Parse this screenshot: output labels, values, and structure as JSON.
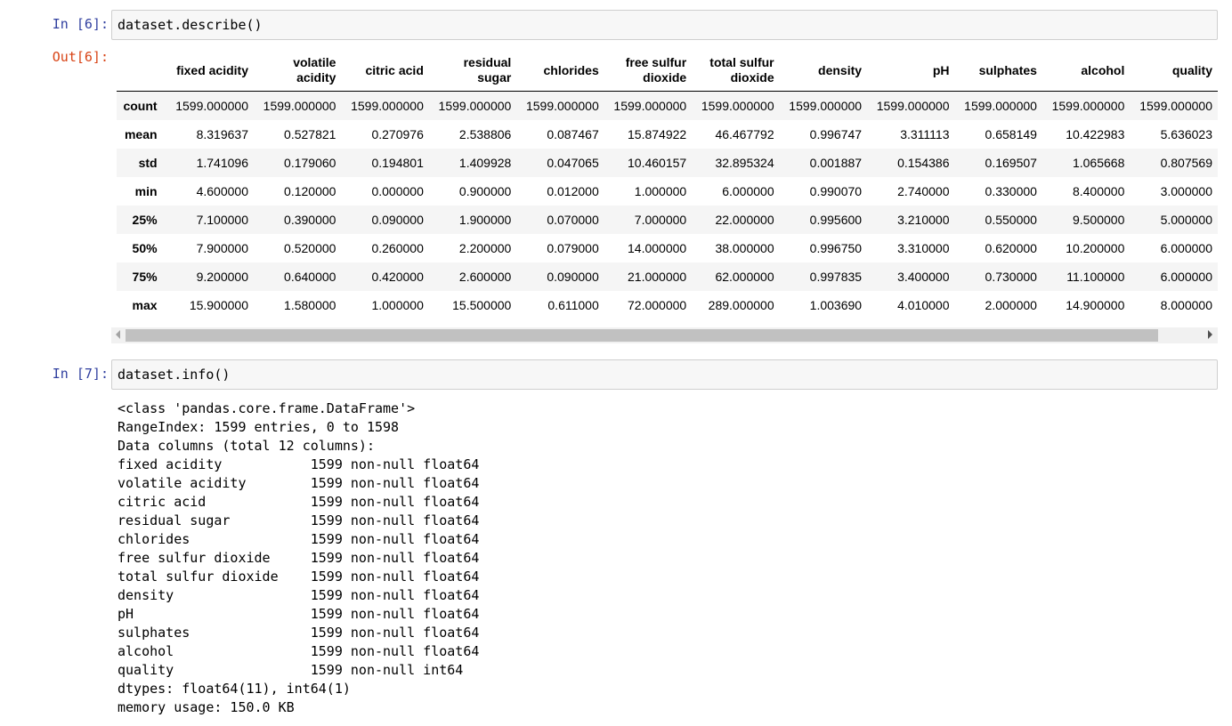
{
  "cell6": {
    "in_prompt": "In [6]:",
    "code": "dataset.describe()",
    "out_prompt": "Out[6]:"
  },
  "describe_table": {
    "columns": [
      [
        "fixed acidity"
      ],
      [
        "volatile",
        "acidity"
      ],
      [
        "citric acid"
      ],
      [
        "residual",
        "sugar"
      ],
      [
        "chlorides"
      ],
      [
        "free sulfur",
        "dioxide"
      ],
      [
        "total sulfur",
        "dioxide"
      ],
      [
        "density"
      ],
      [
        "pH"
      ],
      [
        "sulphates"
      ],
      [
        "alcohol"
      ],
      [
        "quality"
      ]
    ],
    "rows": [
      {
        "label": "count",
        "values": [
          "1599.000000",
          "1599.000000",
          "1599.000000",
          "1599.000000",
          "1599.000000",
          "1599.000000",
          "1599.000000",
          "1599.000000",
          "1599.000000",
          "1599.000000",
          "1599.000000",
          "1599.000000"
        ]
      },
      {
        "label": "mean",
        "values": [
          "8.319637",
          "0.527821",
          "0.270976",
          "2.538806",
          "0.087467",
          "15.874922",
          "46.467792",
          "0.996747",
          "3.311113",
          "0.658149",
          "10.422983",
          "5.636023"
        ]
      },
      {
        "label": "std",
        "values": [
          "1.741096",
          "0.179060",
          "0.194801",
          "1.409928",
          "0.047065",
          "10.460157",
          "32.895324",
          "0.001887",
          "0.154386",
          "0.169507",
          "1.065668",
          "0.807569"
        ]
      },
      {
        "label": "min",
        "values": [
          "4.600000",
          "0.120000",
          "0.000000",
          "0.900000",
          "0.012000",
          "1.000000",
          "6.000000",
          "0.990070",
          "2.740000",
          "0.330000",
          "8.400000",
          "3.000000"
        ]
      },
      {
        "label": "25%",
        "values": [
          "7.100000",
          "0.390000",
          "0.090000",
          "1.900000",
          "0.070000",
          "7.000000",
          "22.000000",
          "0.995600",
          "3.210000",
          "0.550000",
          "9.500000",
          "5.000000"
        ]
      },
      {
        "label": "50%",
        "values": [
          "7.900000",
          "0.520000",
          "0.260000",
          "2.200000",
          "0.079000",
          "14.000000",
          "38.000000",
          "0.996750",
          "3.310000",
          "0.620000",
          "10.200000",
          "6.000000"
        ]
      },
      {
        "label": "75%",
        "values": [
          "9.200000",
          "0.640000",
          "0.420000",
          "2.600000",
          "0.090000",
          "21.000000",
          "62.000000",
          "0.997835",
          "3.400000",
          "0.730000",
          "11.100000",
          "6.000000"
        ]
      },
      {
        "label": "max",
        "values": [
          "15.900000",
          "1.580000",
          "1.000000",
          "15.500000",
          "0.611000",
          "72.000000",
          "289.000000",
          "1.003690",
          "4.010000",
          "2.000000",
          "14.900000",
          "8.000000"
        ]
      }
    ]
  },
  "cell7": {
    "in_prompt": "In [7]:",
    "code": "dataset.info()",
    "output_lines": [
      "<class 'pandas.core.frame.DataFrame'>",
      "RangeIndex: 1599 entries, 0 to 1598",
      "Data columns (total 12 columns):",
      "fixed acidity           1599 non-null float64",
      "volatile acidity        1599 non-null float64",
      "citric acid             1599 non-null float64",
      "residual sugar          1599 non-null float64",
      "chlorides               1599 non-null float64",
      "free sulfur dioxide     1599 non-null float64",
      "total sulfur dioxide    1599 non-null float64",
      "density                 1599 non-null float64",
      "pH                      1599 non-null float64",
      "sulphates               1599 non-null float64",
      "alcohol                 1599 non-null float64",
      "quality                 1599 non-null int64",
      "dtypes: float64(11), int64(1)",
      "memory usage: 150.0 KB"
    ]
  }
}
